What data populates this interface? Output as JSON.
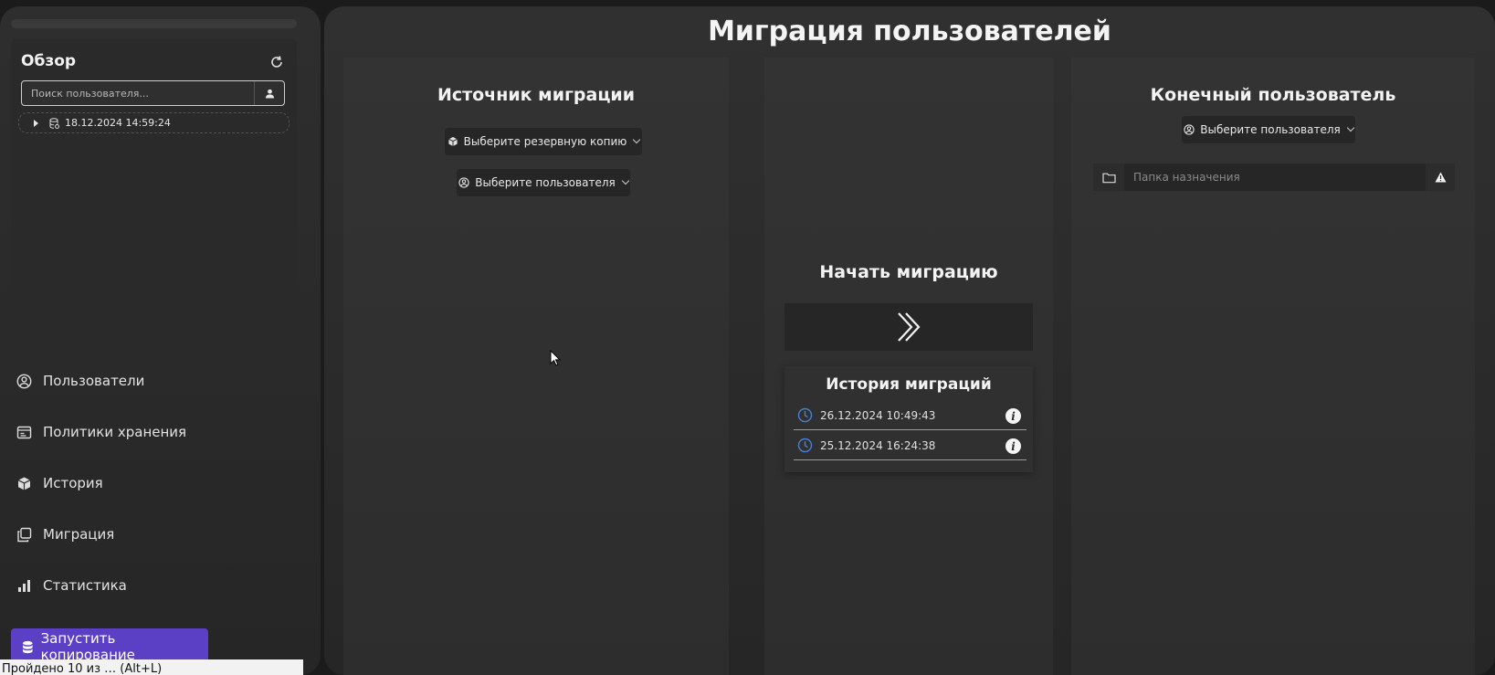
{
  "sidebar": {
    "overview": {
      "title": "Обзор",
      "search_placeholder": "Поиск пользователя...",
      "tree_item": "18.12.2024 14:59:24"
    },
    "nav": [
      {
        "label": "Пользователи",
        "icon": "user-circle-icon"
      },
      {
        "label": "Политики хранения",
        "icon": "storage-policy-icon"
      },
      {
        "label": "История",
        "icon": "box-icon"
      },
      {
        "label": "Миграция",
        "icon": "copy-icon"
      },
      {
        "label": "Статистика",
        "icon": "bar-chart-icon"
      }
    ],
    "start_copy_label": "Запустить копирование",
    "tooltip": "Пройдено 10 из … (Alt+L)"
  },
  "main": {
    "title": "Миграция пользователей",
    "source": {
      "title": "Источник миграции",
      "select_backup": "Выберите резервную копию",
      "select_user": "Выберите пользователя"
    },
    "center": {
      "start_title": "Начать миграцию",
      "history_title": "История миграций",
      "history": [
        {
          "timestamp": "26.12.2024 10:49:43"
        },
        {
          "timestamp": "25.12.2024 16:24:38"
        }
      ]
    },
    "target": {
      "title": "Конечный пользователь",
      "select_user": "Выберите пользователя",
      "folder_placeholder": "Папка назначения"
    }
  },
  "colors": {
    "accent": "#5b3fc4",
    "clock_icon": "#4a7fd0",
    "background": "#1b1b1b"
  }
}
